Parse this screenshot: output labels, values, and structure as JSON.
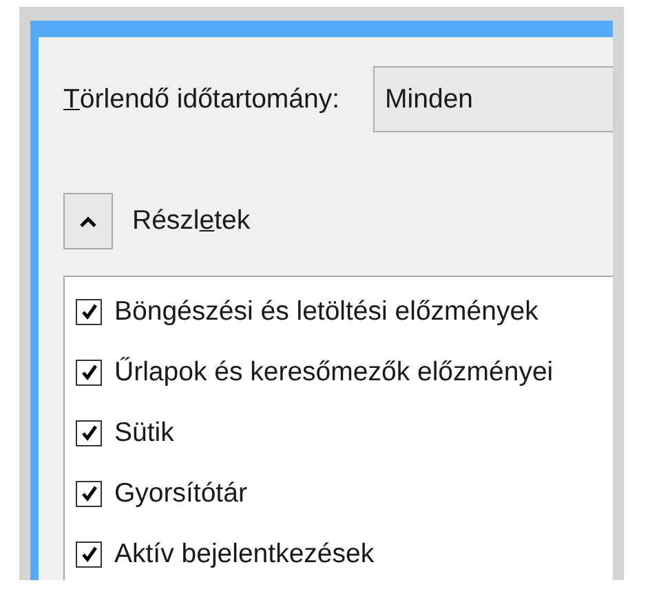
{
  "time_range": {
    "label_key": "T",
    "label_after": "örlendő időtartomány:",
    "value": "Minden"
  },
  "details": {
    "expanded": true,
    "label_before": "Részl",
    "label_key": "e",
    "label_after": "tek"
  },
  "items": [
    {
      "label": "Böngészési és letöltési előzmények",
      "checked": true
    },
    {
      "label": "Űrlapok és keresőmezők előzményei",
      "checked": true
    },
    {
      "label": "Sütik",
      "checked": true
    },
    {
      "label": "Gyorsítótár",
      "checked": true
    },
    {
      "label": "Aktív bejelentkezések",
      "checked": true
    }
  ]
}
